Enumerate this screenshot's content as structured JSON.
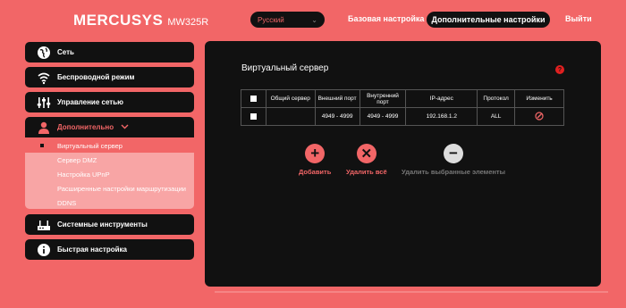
{
  "header": {
    "brand": "MERCUSYS",
    "model": "MW325R",
    "language": "Русский",
    "nav_basic": "Базовая настройка",
    "nav_advanced": "Дополнительные настройки",
    "nav_logout": "Выйти"
  },
  "sidebar": {
    "items": [
      {
        "label": "Сеть",
        "icon": "globe-icon"
      },
      {
        "label": "Беспроводной режим",
        "icon": "wifi-icon"
      },
      {
        "label": "Управление сетью",
        "icon": "sliders-icon"
      },
      {
        "label": "Дополнительно",
        "icon": "user-icon"
      },
      {
        "label": "Системные инструменты",
        "icon": "router-icon"
      },
      {
        "label": "Быстрая настройка",
        "icon": "info-icon"
      }
    ],
    "submenu": [
      "Виртуальный сервер",
      "Сервер DMZ",
      "Настройка UPnP",
      "Расширенные настройки маршрутизации",
      "DDNS"
    ]
  },
  "panel": {
    "title": "Виртуальный сервер",
    "help": "?",
    "columns": [
      "Общий сервер",
      "Внешний порт",
      "Внутренний порт",
      "IP-адрес",
      "Протокол",
      "Изменить"
    ],
    "rows": [
      {
        "common": "",
        "ext_port": "4949 - 4999",
        "int_port": "4949 - 4999",
        "ip": "192.168.1.2",
        "protocol": "ALL"
      }
    ],
    "actions": {
      "add": "Добавить",
      "delete_all": "Удалить всё",
      "remove_selected": "Удалить выбранные элементы"
    }
  },
  "colors": {
    "accent": "#f26667",
    "panel": "#111111",
    "submenu": "#f8a5a5"
  }
}
